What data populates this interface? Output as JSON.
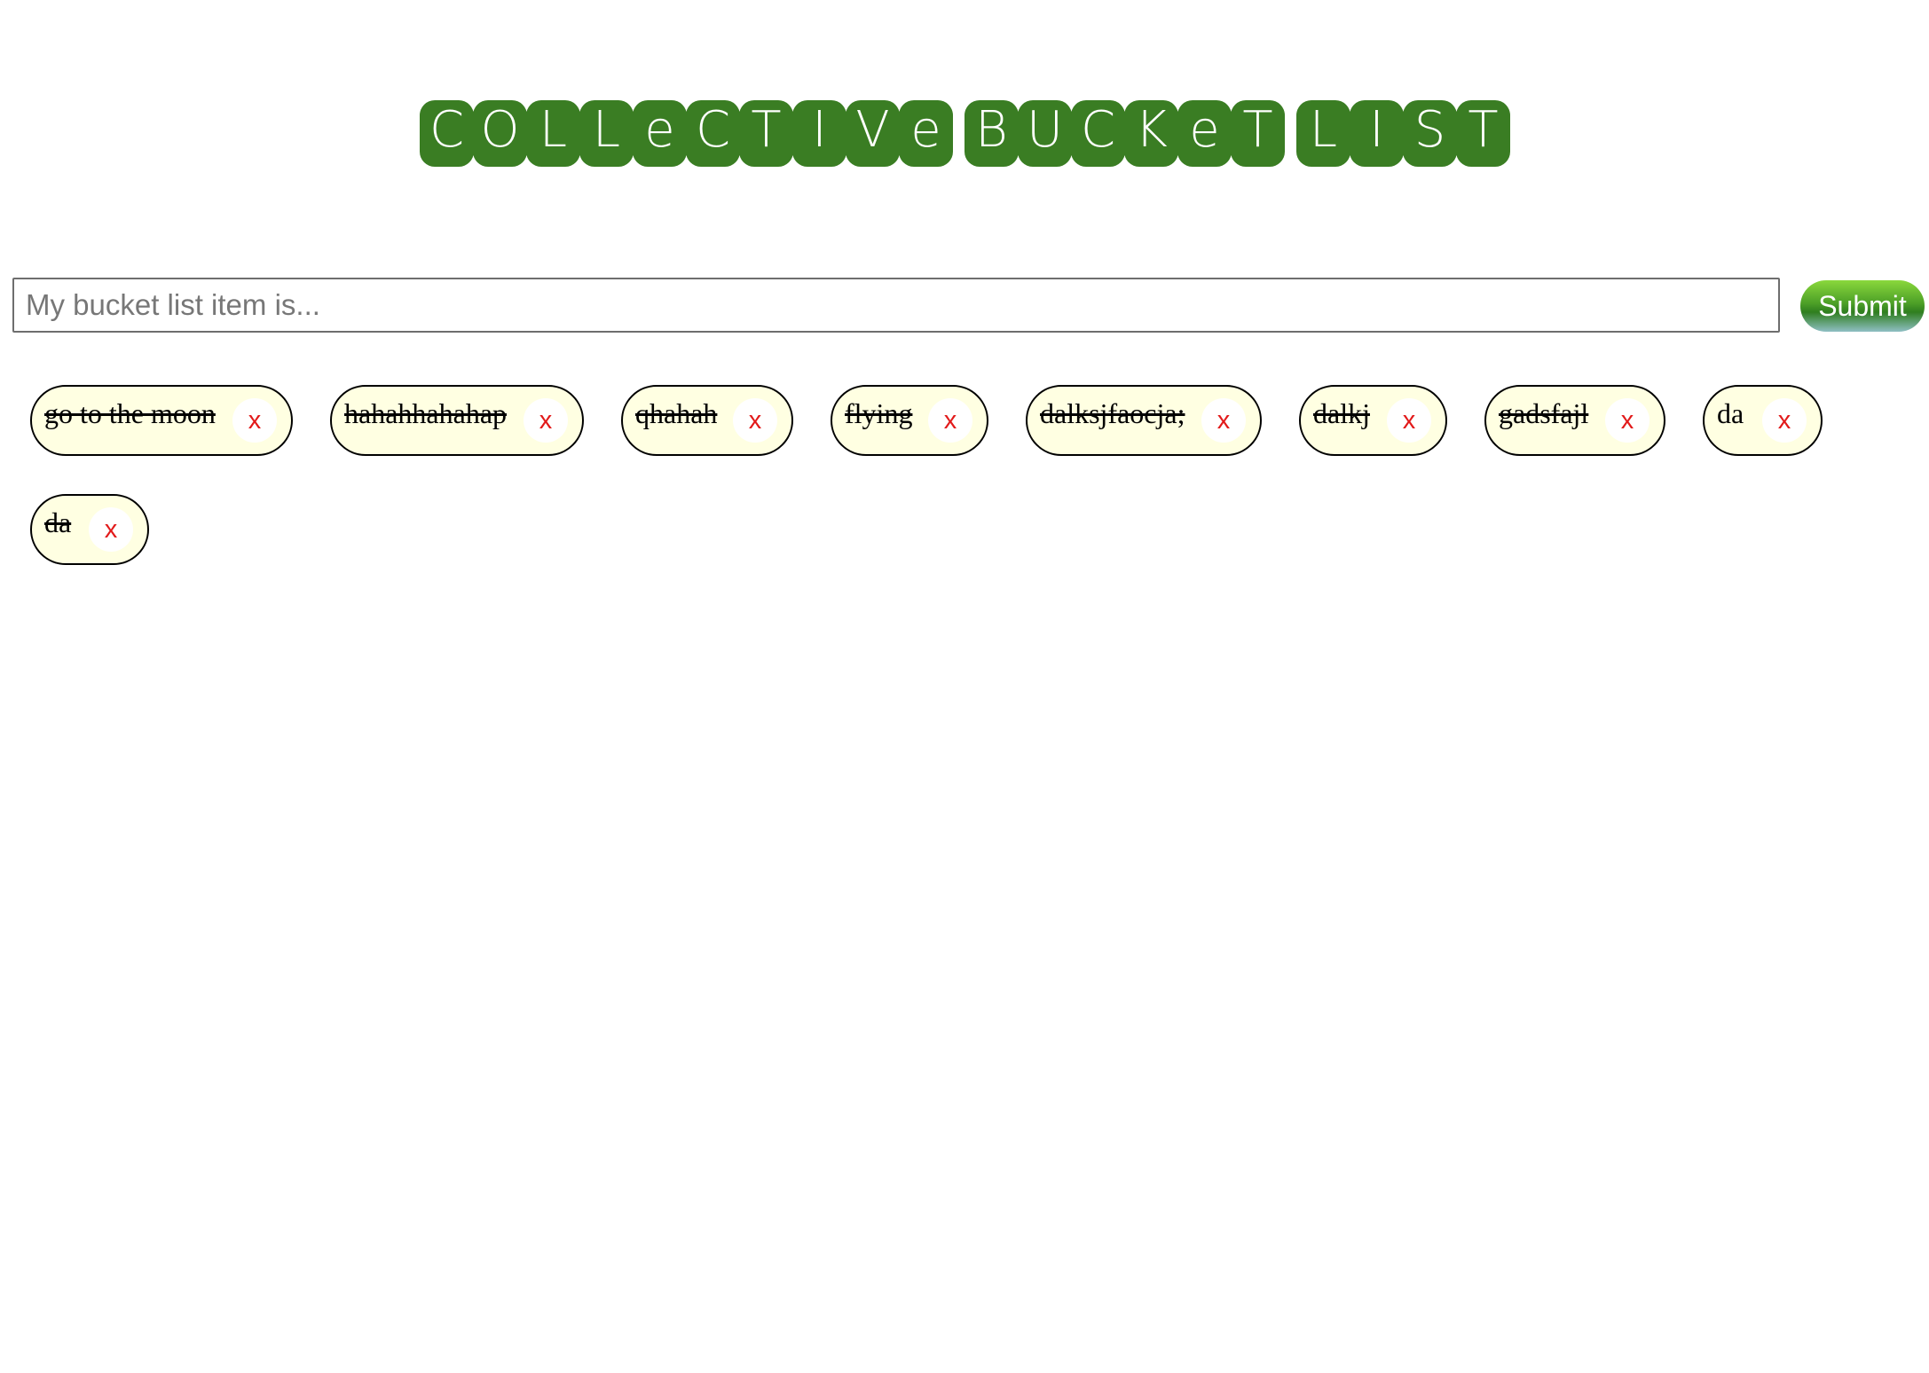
{
  "title": {
    "words": [
      [
        "C",
        "O",
        "L",
        "L",
        "e",
        "C",
        "T",
        "I",
        "V",
        "e"
      ],
      [
        "B",
        "U",
        "C",
        "K",
        "e",
        "T"
      ],
      [
        "L",
        "I",
        "S",
        "T"
      ]
    ]
  },
  "form": {
    "input_placeholder": "My bucket list item is...",
    "input_value": "",
    "submit_label": "Submit"
  },
  "items": [
    {
      "text": "go to the moon",
      "completed": true,
      "delete_label": "x"
    },
    {
      "text": "hahahhahahap",
      "completed": true,
      "delete_label": "x"
    },
    {
      "text": "qhahah",
      "completed": true,
      "delete_label": "x"
    },
    {
      "text": "flying",
      "completed": true,
      "delete_label": "x"
    },
    {
      "text": "dalksjfaocja;",
      "completed": true,
      "delete_label": "x"
    },
    {
      "text": "dalkj",
      "completed": true,
      "delete_label": "x"
    },
    {
      "text": "gadsfajl",
      "completed": true,
      "delete_label": "x"
    },
    {
      "text": "da",
      "completed": false,
      "delete_label": "x"
    },
    {
      "text": "da",
      "completed": true,
      "delete_label": "x"
    }
  ],
  "colors": {
    "title_tile": "#3a7d23",
    "item_background": "#ffffe2",
    "delete_text": "#e21a1a",
    "submit_gradient_top": "#8ad83c",
    "submit_gradient_bottom": "#8fbfc4"
  }
}
